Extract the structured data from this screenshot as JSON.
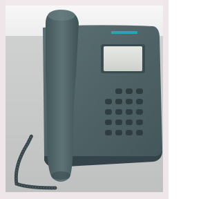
{
  "scene": {
    "subject": "desk-telephone",
    "colors": {
      "background": "#f4eeef",
      "wall": "#f2f2f2",
      "desk": "#c8caca",
      "phone_body": "#4f6467",
      "phone_shadow": "#3e5053",
      "display": "#d8dbd7",
      "key": "#2f3d40",
      "brand_accent": "#28a6b5"
    },
    "icons": [
      "handset-icon",
      "display-screen-icon",
      "keypad-icon",
      "coiled-cord-icon"
    ]
  }
}
